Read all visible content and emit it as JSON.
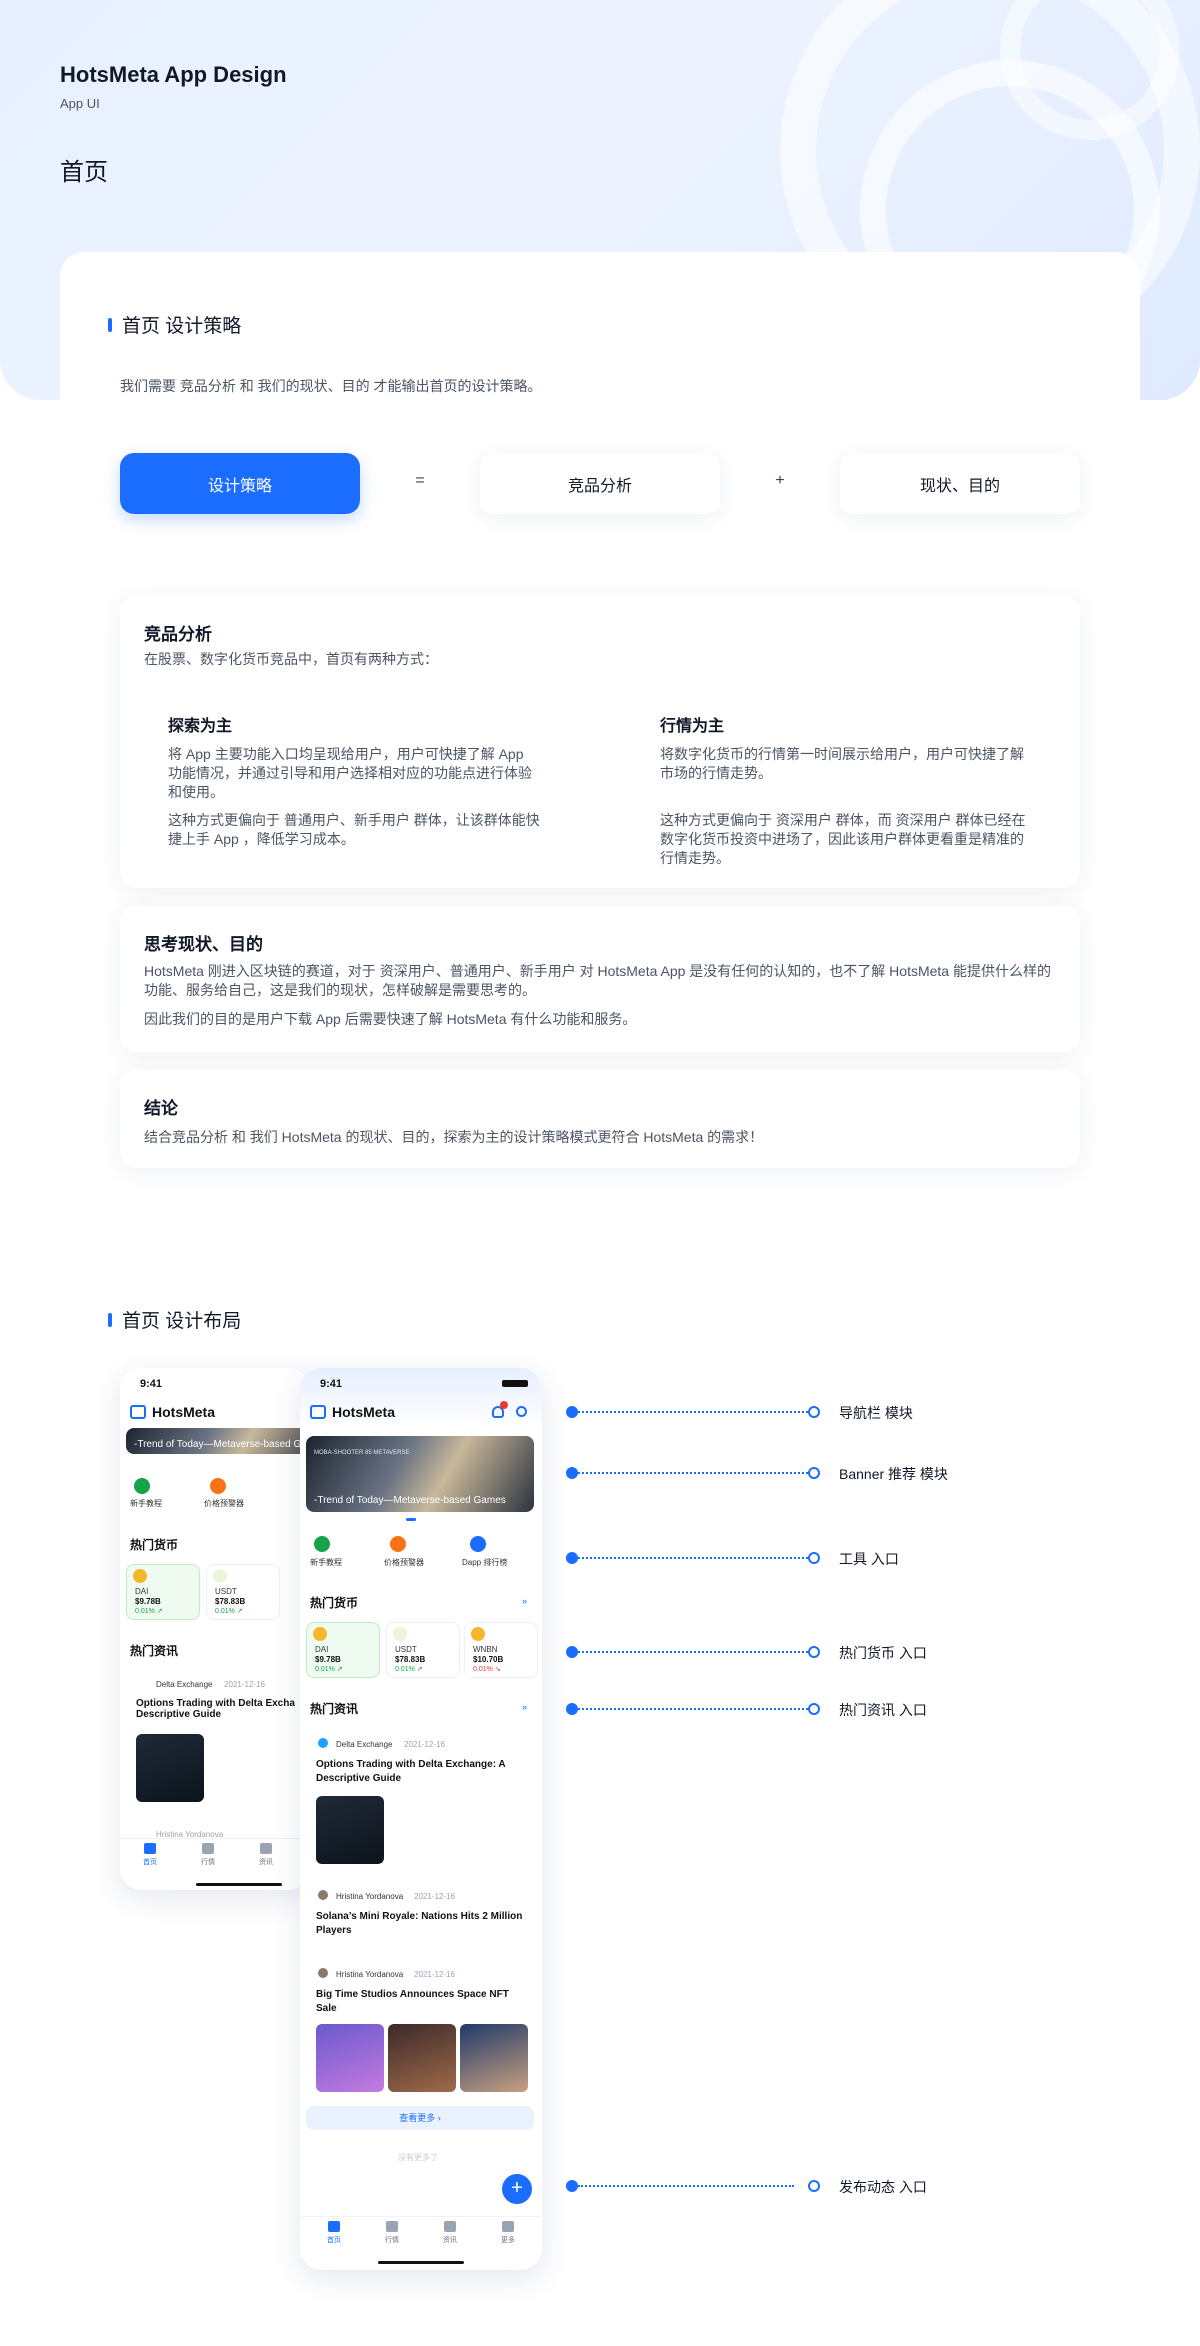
{
  "header": {
    "title": "HotsMeta App Design",
    "subtitle": "App UI",
    "page_title": "首页"
  },
  "strategy": {
    "heading": "首页 设计策略",
    "intro": "我们需要 竞品分析 和 我们的现状、目的 才能输出首页的设计策略。",
    "formula": {
      "result": "设计策略",
      "equals": "=",
      "term1": "竞品分析",
      "plus": "+",
      "term2": "现状、目的"
    },
    "competitor": {
      "title": "竞品分析",
      "desc": "在股票、数字化货币竞品中，首页有两种方式：",
      "left_title": "探索为主",
      "left_p1": "将 App 主要功能入口均呈现给用户，用户可快捷了解 App 功能情况，并通过引导和用户选择相对应的功能点进行体验和使用。",
      "left_p2": "这种方式更偏向于 普通用户、新手用户 群体，让该群体能快捷上手 App ，降低学习成本。",
      "right_title": "行情为主",
      "right_p1": "将数字化货币的行情第一时间展示给用户，用户可快捷了解市场的行情走势。",
      "right_p2": "这种方式更偏向于 资深用户 群体，而 资深用户 群体已经在数字化货币投资中进场了，因此该用户群体更看重是精准的行情走势。"
    },
    "thinking": {
      "title": "思考现状、目的",
      "p1": "HotsMeta 刚进入区块链的赛道，对于 资深用户、普通用户、新手用户 对 HotsMeta App 是没有任何的认知的，也不了解 HotsMeta 能提供什么样的功能、服务给自己，这是我们的现状，怎样破解是需要思考的。",
      "p2": "因此我们的目的是用户下载 App 后需要快速了解 HotsMeta 有什么功能和服务。"
    },
    "conclusion": {
      "title": "结论",
      "text": "结合竞品分析 和 我们 HotsMeta 的现状、目的，探索为主的设计策略模式更符合 HotsMeta 的需求！"
    }
  },
  "layout": {
    "heading": "首页 设计布局",
    "callouts": [
      "导航栏 模块",
      "Banner 推荐 模块",
      "工具 入口",
      "热门货币 入口",
      "热门资讯 入口",
      "发布动态 入口"
    ]
  },
  "phone": {
    "time": "9:41",
    "app_name": "HotsMeta",
    "banner_text": "-Trend of Today—Metaverse-based Games",
    "banner_small": "MOBA-SHOOTER 85 METAVERSE",
    "tools": [
      "新手教程",
      "价格预警器",
      "Dapp 排行榜"
    ],
    "hot_coins_title": "热门货币",
    "coins": [
      {
        "name": "DAI",
        "value": "$9.78B",
        "change": "0.01% ↗"
      },
      {
        "name": "USDT",
        "value": "$78.83B",
        "change": "0.01% ↗"
      },
      {
        "name": "WNBN",
        "value": "$10.70B",
        "change": "0.01% ↘"
      }
    ],
    "hot_news_title": "热门资讯",
    "news": [
      {
        "author": "Delta Exchange",
        "date": "2021-12-16",
        "title": "Options Trading with Delta Exchange: A Descriptive Guide"
      },
      {
        "author": "Hristina Yordanova",
        "date": "2021-12-16",
        "title": "Solana’s Mini Royale: Nations Hits 2 Million Players"
      },
      {
        "author": "Hristina Yordanova",
        "date": "2021-12-16",
        "title": "Big Time Studios Announces Space NFT Sale"
      }
    ],
    "more_label": "查看更多 ›",
    "end_label": "没有更多了",
    "back_title": "Options Trading with Delta Exchange: A Descriptive Guide",
    "back_title_cut": "Options Trading with Delta Excha Descriptive Guide",
    "back_author2": "Hristina Yordanova",
    "tabs": [
      "首页",
      "行情",
      "资讯",
      "更多"
    ],
    "fab": "+"
  },
  "colors": {
    "accent": "#1a6dff",
    "positive": "#16a34a",
    "negative": "#e53935"
  }
}
